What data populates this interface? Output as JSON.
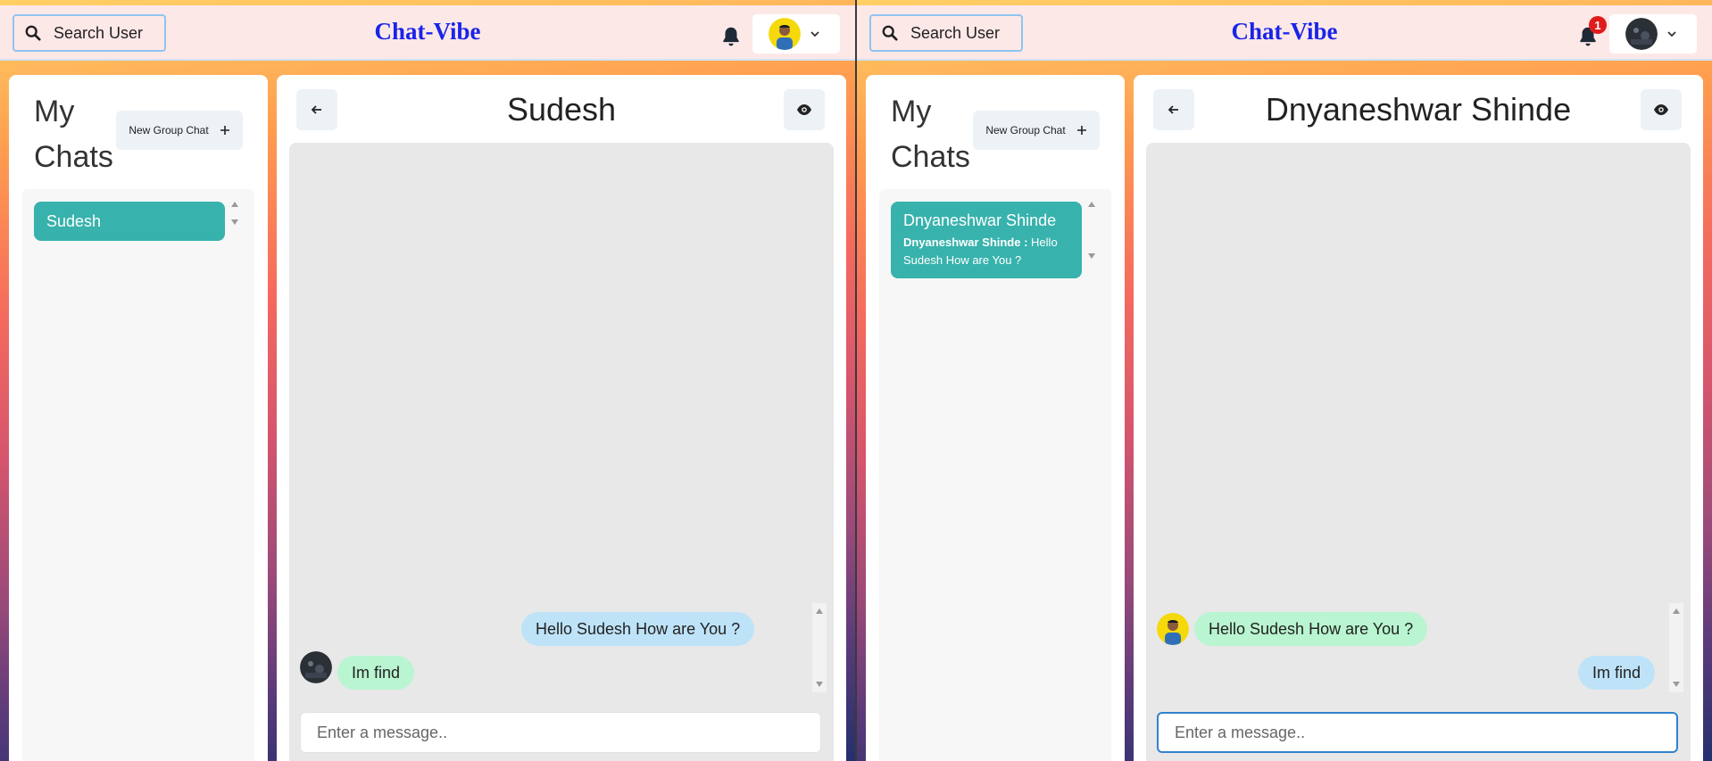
{
  "left": {
    "search": {
      "label": "Search User"
    },
    "brand": "Chat-Vibe",
    "notifications": {
      "count": ""
    },
    "my_chats": {
      "title": "My Chats",
      "new_group_label": "New Group Chat"
    },
    "chats": [
      {
        "name": "Sudesh",
        "latest_sender": "",
        "latest_text": ""
      }
    ],
    "chat": {
      "title": "Sudesh",
      "messages": [
        {
          "text": "Hello Sudesh How are You ?",
          "side": "right",
          "color": "#bee3f8"
        },
        {
          "text": "Im find",
          "side": "left",
          "color": "#b9f5d0",
          "avatar": "dark-profile-photo"
        }
      ],
      "input_placeholder": "Enter a message.."
    }
  },
  "right": {
    "search": {
      "label": "Search User"
    },
    "brand": "Chat-Vibe",
    "notifications": {
      "count": "1"
    },
    "my_chats": {
      "title": "My Chats",
      "new_group_label": "New Group Chat"
    },
    "chats": [
      {
        "name": "Dnyaneshwar Shinde",
        "latest_sender": "Dnyaneshwar Shinde :",
        "latest_text": "Hello Sudesh How are You ?"
      }
    ],
    "chat": {
      "title": "Dnyaneshwar Shinde",
      "messages": [
        {
          "text": "Hello Sudesh How are You ?",
          "side": "left",
          "color": "#b9f5d0",
          "avatar": "yellow-profile-photo"
        },
        {
          "text": "Im find",
          "side": "right",
          "color": "#bee3f8"
        }
      ],
      "input_placeholder": "Enter a message.."
    }
  },
  "colors": {
    "brand": "#1a24e8",
    "accent": "#38b2ac",
    "topbar": "#fde8e8",
    "badge": "#e01b1b"
  }
}
